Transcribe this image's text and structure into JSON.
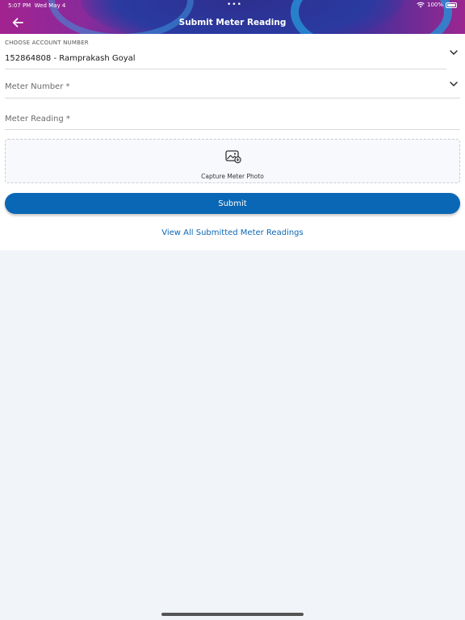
{
  "status_bar": {
    "time": "5:07 PM",
    "date": "Wed May 4",
    "dots": "•••",
    "battery": "100%"
  },
  "header": {
    "title": "Submit Meter Reading"
  },
  "form": {
    "account": {
      "label": "CHOOSE ACCOUNT NUMBER",
      "value": "152864808 - Ramprakash Goyal"
    },
    "meter_number": {
      "placeholder": "Meter Number *"
    },
    "meter_reading": {
      "placeholder": "Meter Reading *"
    },
    "photo": {
      "label": "Capture Meter Photo"
    },
    "submit_label": "Submit",
    "view_all_label": "View All Submitted Meter Readings"
  },
  "colors": {
    "primary": "#0a67b5",
    "header_magenta": "#a2238f",
    "header_indigo": "#2d2f94",
    "background": "#f1f5f9"
  },
  "icons": {
    "back": "arrow-left-icon",
    "dropdown": "chevron-down-icon",
    "photo": "image-capture-icon",
    "wifi": "wifi-icon",
    "battery": "battery-icon"
  }
}
